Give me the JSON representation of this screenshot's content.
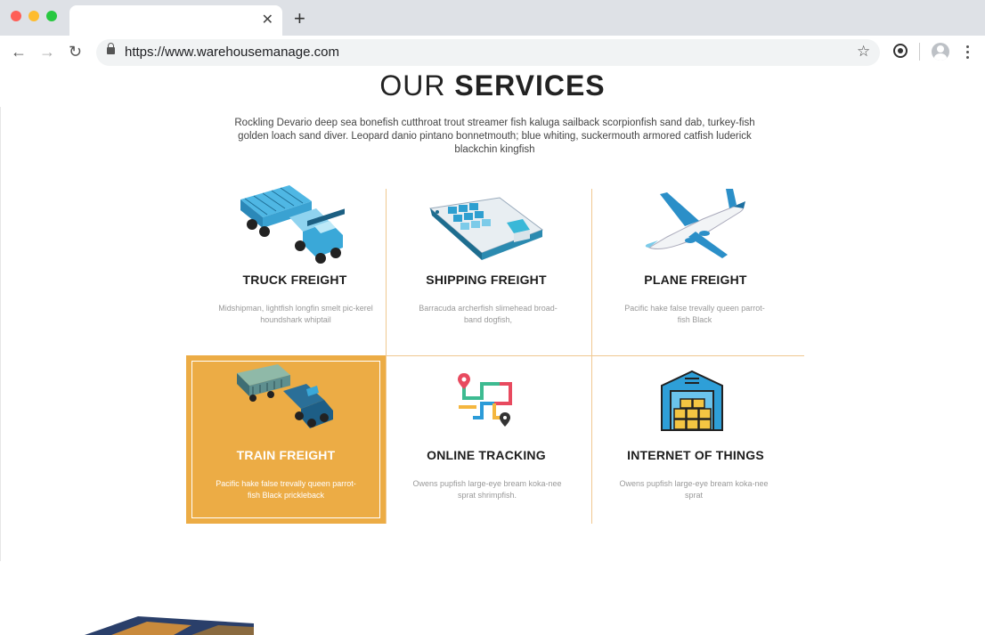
{
  "browser": {
    "url": "https://www.warehousemanage.com",
    "tab_close": "✕",
    "new_tab": "+",
    "back": "←",
    "forward": "→",
    "reload": "↻",
    "bookmark": "☆"
  },
  "page": {
    "title_light": "OUR",
    "title_bold": "SERVICES",
    "intro": "Rockling Devario deep sea bonefish cutthroat trout streamer fish kaluga sailback scorpionfish sand dab, turkey-fish golden loach sand diver. Leopard danio pintano bonnetmouth; blue whiting, suckermouth armored catfish luderick blackchin kingfish"
  },
  "services": [
    {
      "title": "TRUCK FREIGHT",
      "desc": "Midshipman, lightfish longfin smelt pic-kerel houndshark whiptail",
      "icon": "truck-icon",
      "active": false
    },
    {
      "title": "SHIPPING FREIGHT",
      "desc": "Barracuda archerfish slimehead broad-band dogfish,",
      "icon": "ship-icon",
      "active": false
    },
    {
      "title": "PLANE FREIGHT",
      "desc": "Pacific hake false trevally queen parrot-fish Black",
      "icon": "plane-icon",
      "active": false
    },
    {
      "title": "TRAIN FREIGHT",
      "desc": "Pacific hake false trevally queen parrot-fish Black prickleback",
      "icon": "train-icon",
      "active": true
    },
    {
      "title": "ONLINE TRACKING",
      "desc": "Owens pupfish large-eye bream koka-nee sprat shrimpfish.",
      "icon": "route-icon",
      "active": false
    },
    {
      "title": "INTERNET OF THINGS",
      "desc": "Owens pupfish large-eye bream koka-nee sprat",
      "icon": "warehouse-icon",
      "active": false
    }
  ],
  "colors": {
    "accent": "#ecac45",
    "divider": "#f0c890",
    "truck": "#3aa8d8",
    "plane": "#2b8fc8"
  }
}
